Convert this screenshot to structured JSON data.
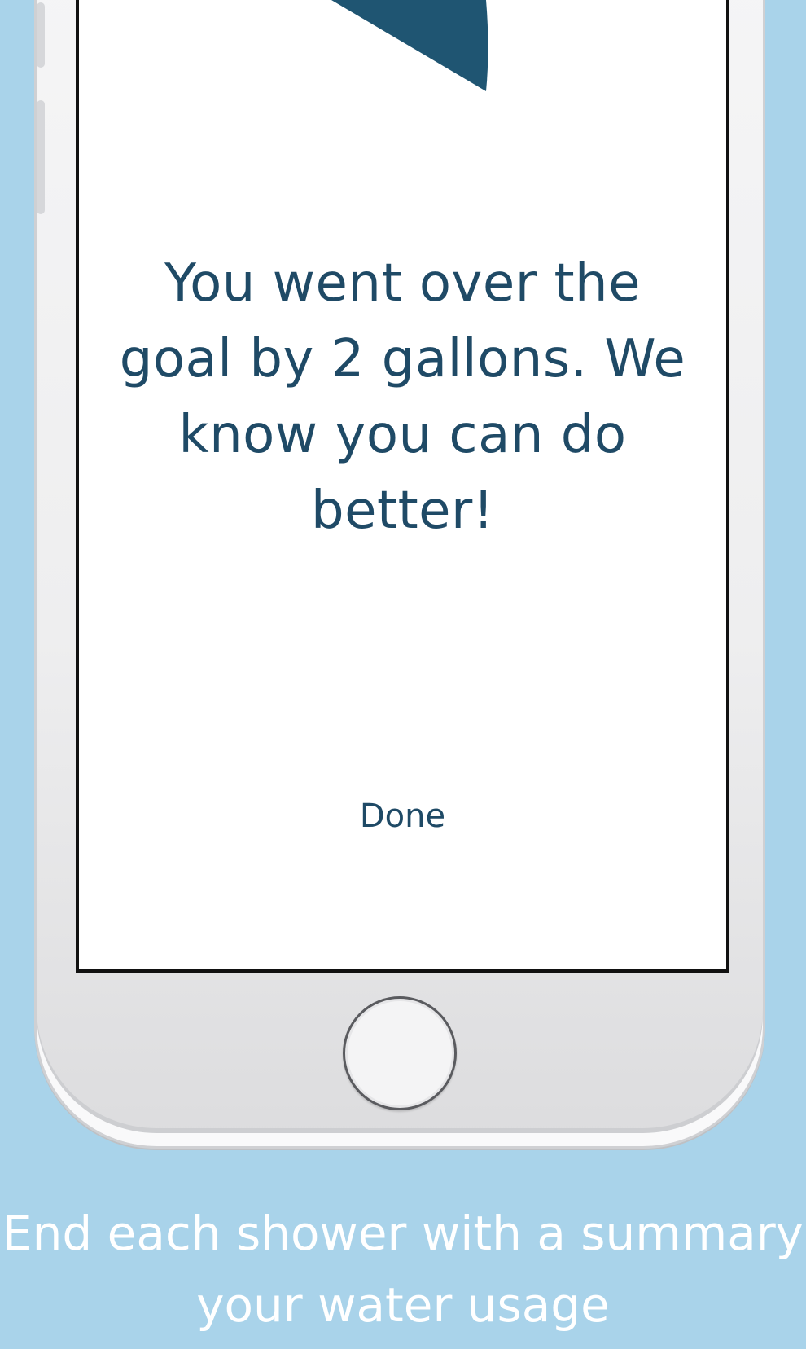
{
  "screen": {
    "message": "You went over the goal by 2 gallons. We know you can do better!",
    "done_label": "Done"
  },
  "caption": {
    "text": "End each shower with a summary your water usage"
  },
  "colors": {
    "background": "#a9d3ea",
    "accent": "#1f4a66",
    "graphic": "#1f5572",
    "screen": "#ffffff"
  },
  "icons": {
    "graphic": "partial-circle-graphic",
    "home": "home-button"
  }
}
